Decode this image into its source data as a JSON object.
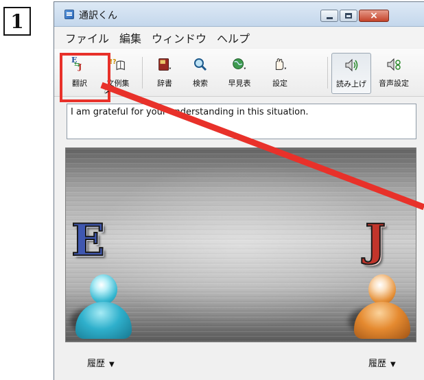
{
  "step_number": "1",
  "window": {
    "title": "通訳くん",
    "close_glyph": "×"
  },
  "menu": [
    "ファイル",
    "編集",
    "ウィンドウ",
    "ヘルプ"
  ],
  "toolbar": {
    "translate": "翻訳",
    "examples": "文例集",
    "dictionary": "辞書",
    "search": "検索",
    "quick_table": "早見表",
    "settings": "設定",
    "read_aloud": "読み上げ",
    "voice_settings": "音声設定"
  },
  "input_text": "I am grateful for your understanding in this situation.",
  "panel": {
    "source_letter": "E",
    "target_letter": "J"
  },
  "history_left": "履歴",
  "history_right": "履歴",
  "colors": {
    "highlight": "#e8312a",
    "arrow": "#e8312a"
  },
  "icons": {
    "translate": "ej-translate-icon",
    "examples": "book-question-icon",
    "dictionary": "dictionary-icon",
    "search": "magnifier-icon",
    "quick_table": "globe-icon",
    "settings": "hand-settings-icon",
    "read_aloud": "speaker-icon",
    "voice_settings": "voice-settings-icon",
    "cursor": "mouse-pointer-icon"
  }
}
